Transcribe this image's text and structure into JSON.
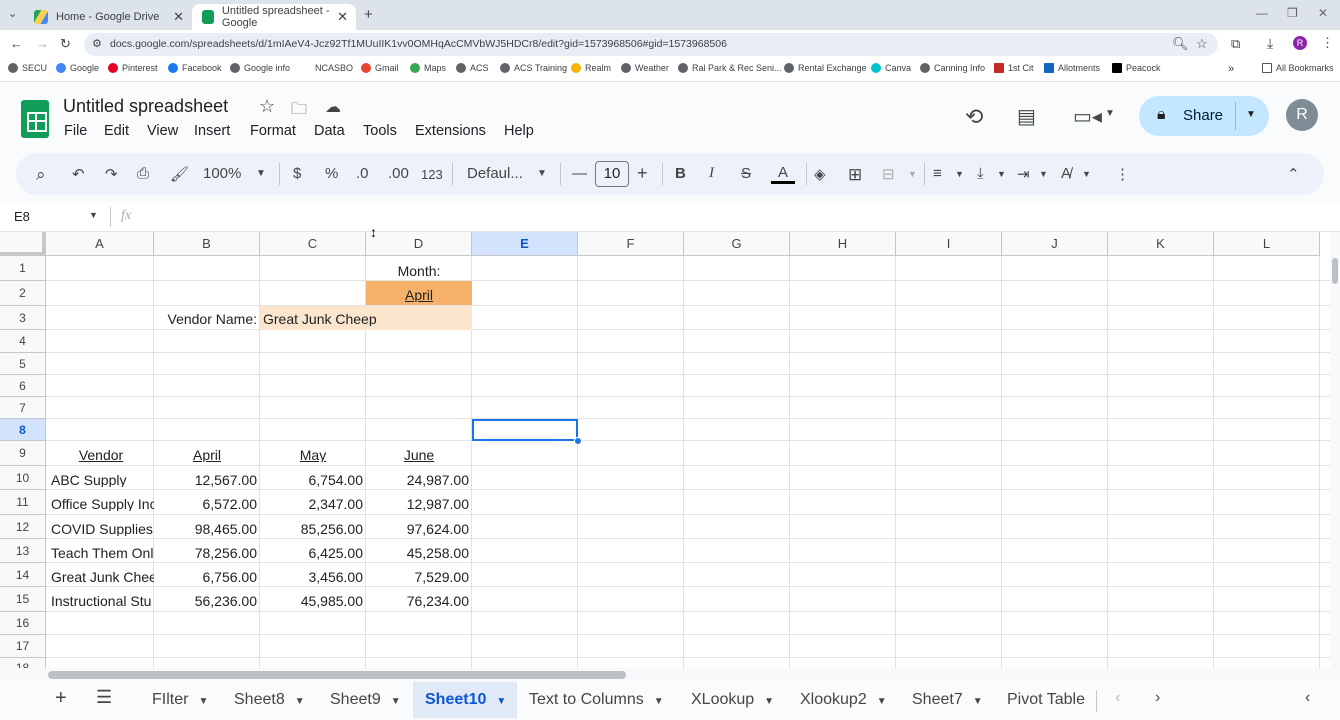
{
  "browser": {
    "tabs": [
      {
        "title": "Home - Google Drive"
      },
      {
        "title": "Untitled spreadsheet - Google"
      }
    ],
    "url": "docs.google.com/spreadsheets/d/1mIAeV4-Jcz92Tf1MUuIIK1vv0OMHqAcCMVbWJ5HDCr8/edit?gid=1573968506#gid=1573968506",
    "bookmarks": [
      "SECU",
      "Google",
      "Pinterest",
      "Facebook",
      "Google info",
      "NCASBO",
      "Gmail",
      "Maps",
      "ACS",
      "ACS Training",
      "Realm",
      "Weather",
      "Ral Park & Rec Seni...",
      "Rental Exchange",
      "Canva",
      "Canning Info",
      "1st Cit",
      "Allotments",
      "Peacock"
    ],
    "all_bookmarks": "All Bookmarks",
    "profile_initial": "R"
  },
  "doc": {
    "title": "Untitled spreadsheet",
    "menus": [
      "File",
      "Edit",
      "View",
      "Insert",
      "Format",
      "Data",
      "Tools",
      "Extensions",
      "Help"
    ],
    "share_label": "Share",
    "avatar": "R"
  },
  "toolbar": {
    "zoom": "100%",
    "currency": "$",
    "percent": "%",
    "dec_less": ".0",
    "dec_more": ".00",
    "format_num": "123",
    "font": "Defaul...",
    "font_size": "10",
    "bold": "B",
    "italic": "I",
    "strike": "S",
    "text_color": "A"
  },
  "formula_bar": {
    "cell_ref": "E8",
    "fx": "fx",
    "value": ""
  },
  "columns": [
    "A",
    "B",
    "C",
    "D",
    "E",
    "F",
    "G",
    "H",
    "I",
    "J",
    "K",
    "L"
  ],
  "selected_column": "E",
  "rows": [
    "1",
    "2",
    "3",
    "4",
    "5",
    "6",
    "7",
    "8",
    "9",
    "10",
    "11",
    "12",
    "13",
    "14",
    "15",
    "16",
    "17",
    "18"
  ],
  "selected_row": "8",
  "cells": {
    "D1": "Month:",
    "D2": "April",
    "B3": "Vendor Name:",
    "C3": "Great Junk Cheep",
    "headers": [
      "Vendor",
      "April",
      "May",
      "June"
    ],
    "data": [
      [
        "ABC Supply",
        "12,567.00",
        "6,754.00",
        "24,987.00"
      ],
      [
        "Office Supply Inc",
        "6,572.00",
        "2,347.00",
        "12,987.00"
      ],
      [
        "COVID Supplies F",
        "98,465.00",
        "85,256.00",
        "97,624.00"
      ],
      [
        "Teach Them Onli",
        "78,256.00",
        "6,425.00",
        "45,258.00"
      ],
      [
        "Great Junk Chee",
        "6,756.00",
        "3,456.00",
        "7,529.00"
      ],
      [
        "Instructional Stu",
        "56,236.00",
        "45,985.00",
        "76,234.00"
      ]
    ]
  },
  "sheets": [
    "FIlter",
    "Sheet8",
    "Sheet9",
    "Sheet10",
    "Text to Columns",
    "XLookup",
    "Xlookup2",
    "Sheet7",
    "Pivot Table"
  ],
  "active_sheet": "Sheet10",
  "colors": {
    "highlight_dark": "#f6b26b",
    "highlight_light": "#fce5cd",
    "selection": "#1a73e8"
  }
}
